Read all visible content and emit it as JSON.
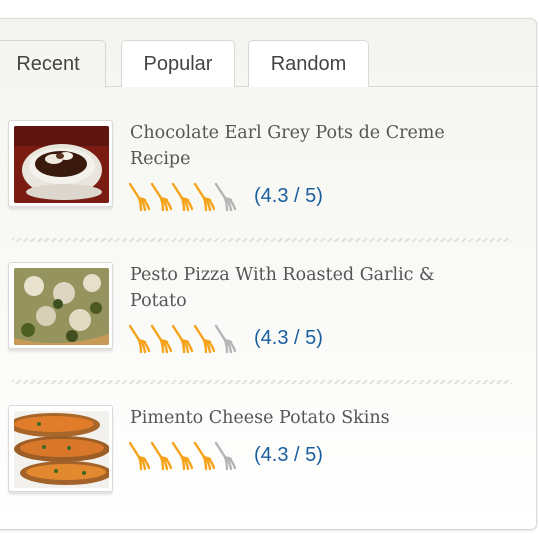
{
  "tabs": [
    {
      "label": "Recent",
      "active": true
    },
    {
      "label": "Popular",
      "active": false
    },
    {
      "label": "Random",
      "active": false
    }
  ],
  "recipes": [
    {
      "title": "Chocolate Earl Grey Pots de Creme Recipe",
      "rating": 4.3,
      "rating_text": "(4.3 / 5)",
      "filled_forks": 4,
      "total_forks": 5
    },
    {
      "title": "Pesto Pizza With Roasted Garlic & Potato",
      "rating": 4.3,
      "rating_text": "(4.3 / 5)",
      "filled_forks": 4,
      "total_forks": 5
    },
    {
      "title": "Pimento Cheese Potato Skins",
      "rating": 4.3,
      "rating_text": "(4.3 / 5)",
      "filled_forks": 4,
      "total_forks": 5
    }
  ],
  "colors": {
    "fork_filled": "#f5a31a",
    "fork_empty": "#b5b5b5",
    "rating_text": "#1a5ea0",
    "title_text": "#555555"
  },
  "icons": {
    "rating_icon": "fork-icon"
  }
}
